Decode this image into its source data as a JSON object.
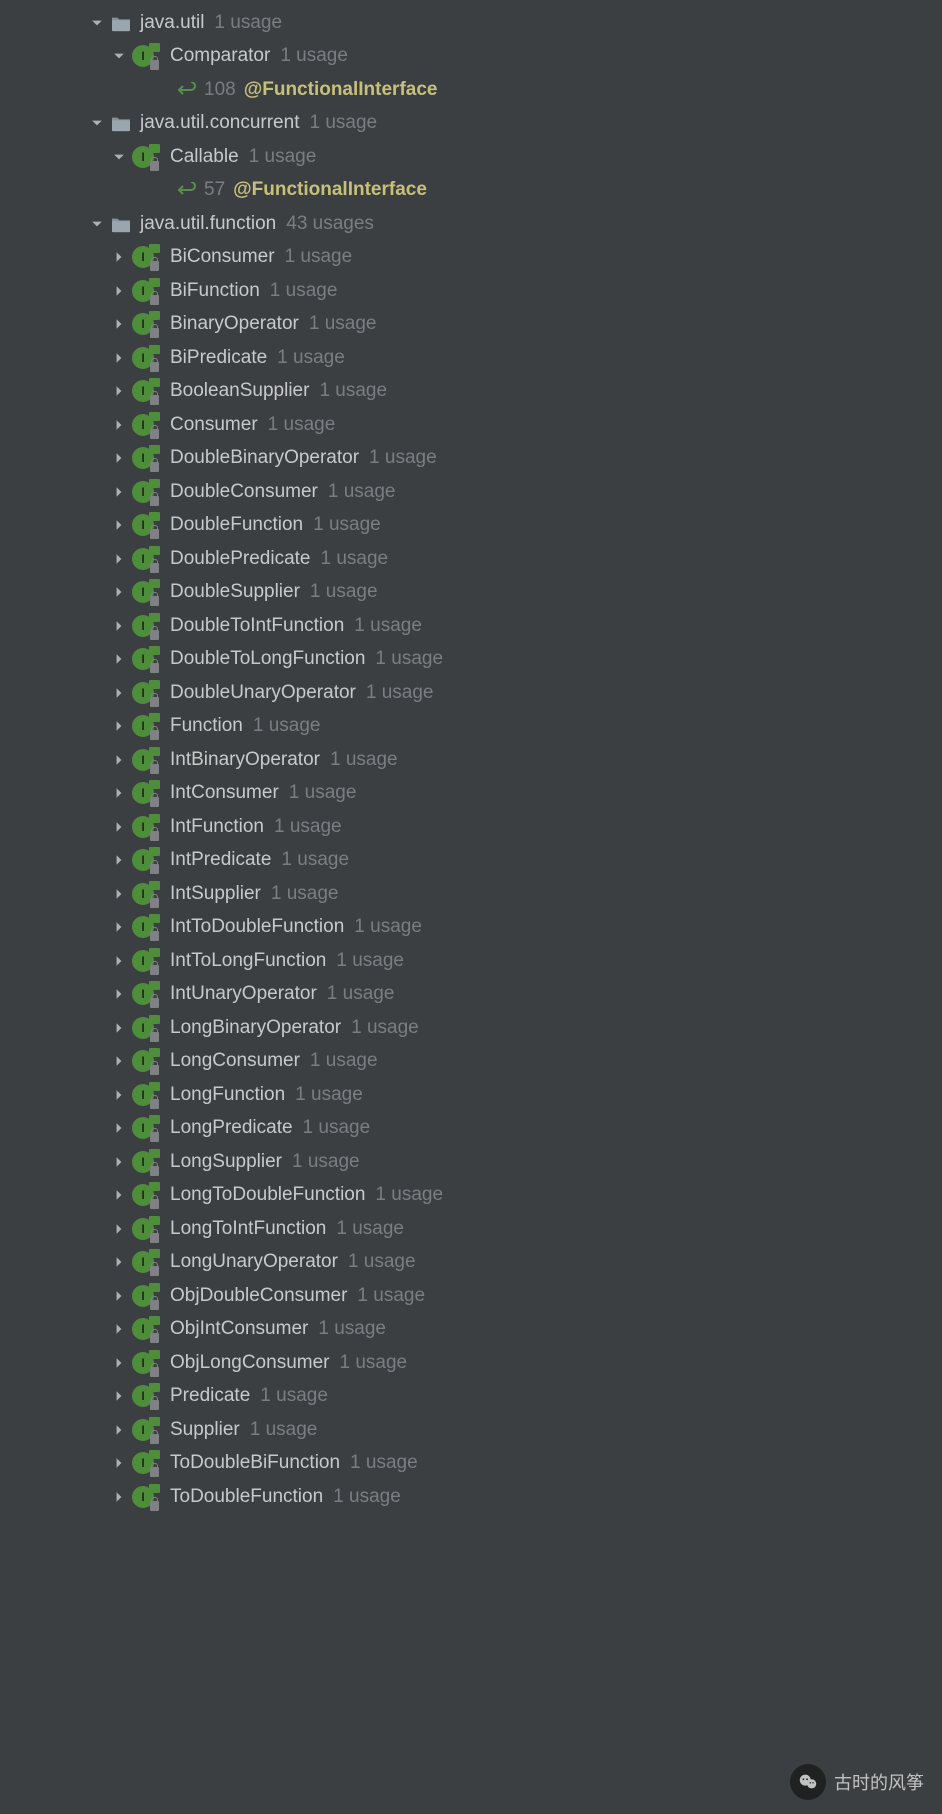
{
  "annotation": "@FunctionalInterface",
  "watermark": "古时的风筝",
  "tree": [
    {
      "type": "pkg",
      "expanded": true,
      "level": 0,
      "name": "java.util",
      "usages": "1 usage"
    },
    {
      "type": "if",
      "expanded": true,
      "level": 1,
      "name": "Comparator",
      "usages": "1 usage"
    },
    {
      "type": "ref",
      "level": 2,
      "line": "108"
    },
    {
      "type": "pkg",
      "expanded": true,
      "level": 0,
      "name": "java.util.concurrent",
      "usages": "1 usage"
    },
    {
      "type": "if",
      "expanded": true,
      "level": 1,
      "name": "Callable",
      "usages": "1 usage"
    },
    {
      "type": "ref",
      "level": 2,
      "line": "57"
    },
    {
      "type": "pkg",
      "expanded": true,
      "level": 0,
      "name": "java.util.function",
      "usages": "43 usages"
    },
    {
      "type": "if",
      "expanded": false,
      "level": 1,
      "name": "BiConsumer",
      "usages": "1 usage"
    },
    {
      "type": "if",
      "expanded": false,
      "level": 1,
      "name": "BiFunction",
      "usages": "1 usage"
    },
    {
      "type": "if",
      "expanded": false,
      "level": 1,
      "name": "BinaryOperator",
      "usages": "1 usage"
    },
    {
      "type": "if",
      "expanded": false,
      "level": 1,
      "name": "BiPredicate",
      "usages": "1 usage"
    },
    {
      "type": "if",
      "expanded": false,
      "level": 1,
      "name": "BooleanSupplier",
      "usages": "1 usage"
    },
    {
      "type": "if",
      "expanded": false,
      "level": 1,
      "name": "Consumer",
      "usages": "1 usage"
    },
    {
      "type": "if",
      "expanded": false,
      "level": 1,
      "name": "DoubleBinaryOperator",
      "usages": "1 usage"
    },
    {
      "type": "if",
      "expanded": false,
      "level": 1,
      "name": "DoubleConsumer",
      "usages": "1 usage"
    },
    {
      "type": "if",
      "expanded": false,
      "level": 1,
      "name": "DoubleFunction",
      "usages": "1 usage"
    },
    {
      "type": "if",
      "expanded": false,
      "level": 1,
      "name": "DoublePredicate",
      "usages": "1 usage"
    },
    {
      "type": "if",
      "expanded": false,
      "level": 1,
      "name": "DoubleSupplier",
      "usages": "1 usage"
    },
    {
      "type": "if",
      "expanded": false,
      "level": 1,
      "name": "DoubleToIntFunction",
      "usages": "1 usage"
    },
    {
      "type": "if",
      "expanded": false,
      "level": 1,
      "name": "DoubleToLongFunction",
      "usages": "1 usage"
    },
    {
      "type": "if",
      "expanded": false,
      "level": 1,
      "name": "DoubleUnaryOperator",
      "usages": "1 usage"
    },
    {
      "type": "if",
      "expanded": false,
      "level": 1,
      "name": "Function",
      "usages": "1 usage"
    },
    {
      "type": "if",
      "expanded": false,
      "level": 1,
      "name": "IntBinaryOperator",
      "usages": "1 usage"
    },
    {
      "type": "if",
      "expanded": false,
      "level": 1,
      "name": "IntConsumer",
      "usages": "1 usage"
    },
    {
      "type": "if",
      "expanded": false,
      "level": 1,
      "name": "IntFunction",
      "usages": "1 usage"
    },
    {
      "type": "if",
      "expanded": false,
      "level": 1,
      "name": "IntPredicate",
      "usages": "1 usage"
    },
    {
      "type": "if",
      "expanded": false,
      "level": 1,
      "name": "IntSupplier",
      "usages": "1 usage"
    },
    {
      "type": "if",
      "expanded": false,
      "level": 1,
      "name": "IntToDoubleFunction",
      "usages": "1 usage"
    },
    {
      "type": "if",
      "expanded": false,
      "level": 1,
      "name": "IntToLongFunction",
      "usages": "1 usage"
    },
    {
      "type": "if",
      "expanded": false,
      "level": 1,
      "name": "IntUnaryOperator",
      "usages": "1 usage"
    },
    {
      "type": "if",
      "expanded": false,
      "level": 1,
      "name": "LongBinaryOperator",
      "usages": "1 usage"
    },
    {
      "type": "if",
      "expanded": false,
      "level": 1,
      "name": "LongConsumer",
      "usages": "1 usage"
    },
    {
      "type": "if",
      "expanded": false,
      "level": 1,
      "name": "LongFunction",
      "usages": "1 usage"
    },
    {
      "type": "if",
      "expanded": false,
      "level": 1,
      "name": "LongPredicate",
      "usages": "1 usage"
    },
    {
      "type": "if",
      "expanded": false,
      "level": 1,
      "name": "LongSupplier",
      "usages": "1 usage"
    },
    {
      "type": "if",
      "expanded": false,
      "level": 1,
      "name": "LongToDoubleFunction",
      "usages": "1 usage"
    },
    {
      "type": "if",
      "expanded": false,
      "level": 1,
      "name": "LongToIntFunction",
      "usages": "1 usage"
    },
    {
      "type": "if",
      "expanded": false,
      "level": 1,
      "name": "LongUnaryOperator",
      "usages": "1 usage"
    },
    {
      "type": "if",
      "expanded": false,
      "level": 1,
      "name": "ObjDoubleConsumer",
      "usages": "1 usage"
    },
    {
      "type": "if",
      "expanded": false,
      "level": 1,
      "name": "ObjIntConsumer",
      "usages": "1 usage"
    },
    {
      "type": "if",
      "expanded": false,
      "level": 1,
      "name": "ObjLongConsumer",
      "usages": "1 usage"
    },
    {
      "type": "if",
      "expanded": false,
      "level": 1,
      "name": "Predicate",
      "usages": "1 usage"
    },
    {
      "type": "if",
      "expanded": false,
      "level": 1,
      "name": "Supplier",
      "usages": "1 usage"
    },
    {
      "type": "if",
      "expanded": false,
      "level": 1,
      "name": "ToDoubleBiFunction",
      "usages": "1 usage"
    },
    {
      "type": "if",
      "expanded": false,
      "level": 1,
      "name": "ToDoubleFunction",
      "usages": "1 usage"
    }
  ]
}
